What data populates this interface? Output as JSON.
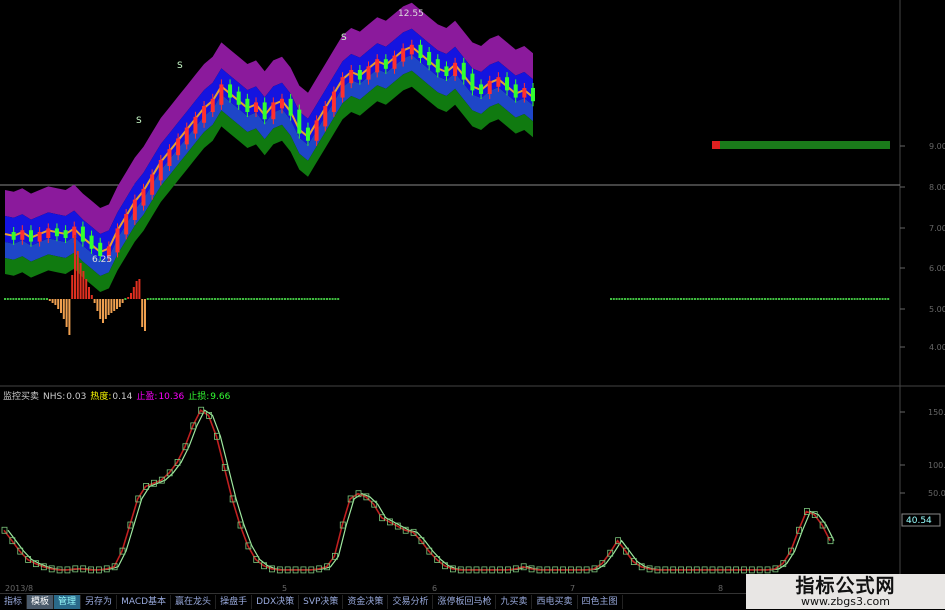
{
  "chart_data": [
    {
      "type": "candlestick",
      "y_axis_ticks": [
        "9.00",
        "8.00",
        "7.00",
        "6.00",
        "5.00",
        "4.00"
      ],
      "ylim": [
        3.2,
        9.6
      ],
      "annotations": {
        "high_label": "12.55",
        "low_label": "6.25",
        "signal_marks": [
          "S",
          "S",
          "S"
        ]
      },
      "price_path": [
        7.3,
        7.25,
        7.35,
        7.2,
        7.3,
        7.4,
        7.35,
        7.3,
        7.45,
        7.2,
        7.0,
        6.8,
        6.9,
        7.4,
        7.8,
        8.2,
        8.5,
        8.9,
        9.3,
        9.6,
        9.9,
        10.2,
        10.5,
        10.8,
        11.0,
        11.4,
        11.2,
        11.0,
        10.8,
        10.9,
        10.6,
        10.9,
        11.0,
        10.7,
        10.2,
        10.0,
        10.4,
        10.8,
        11.2,
        11.6,
        11.8,
        11.7,
        11.9,
        12.1,
        12.0,
        12.2,
        12.4,
        12.5,
        12.3,
        12.1,
        11.9,
        11.8,
        12.0,
        11.7,
        11.4,
        11.3,
        11.5,
        11.6,
        11.4,
        11.2,
        11.3,
        11.1
      ],
      "oscillator": {
        "values": [
          0,
          0,
          0,
          0,
          0,
          0,
          0,
          0,
          0,
          0,
          0,
          0,
          0,
          0,
          0,
          0,
          -0.05,
          -0.1,
          -0.15,
          -0.25,
          -0.35,
          -0.5,
          -0.7,
          -0.9,
          0.6,
          1.6,
          1.2,
          0.9,
          0.7,
          0.5,
          0.3,
          0.1,
          -0.1,
          -0.3,
          -0.5,
          -0.6,
          -0.5,
          -0.4,
          -0.35,
          -0.3,
          -0.25,
          -0.2,
          -0.1,
          0,
          0.05,
          0.15,
          0.3,
          0.45,
          0.5,
          -0.7,
          -0.8
        ],
        "colors": {
          "positive": "#e03020",
          "negative": "#f0a050",
          "zero": "#3fbf3f"
        }
      },
      "far_right_price": 9.0
    },
    {
      "type": "line",
      "header": {
        "indicator": "监控买卖",
        "nhs_label": "NHS:",
        "nhs_value": "0.03",
        "heat_label": "热度:",
        "heat_value": "0.14",
        "stop_loss_label": "止盈:",
        "stop_loss_value": "10.36",
        "stop_profit_label": "止损:",
        "stop_profit_value": "9.66"
      },
      "y_axis_ticks": [
        "150.00",
        "100.00",
        "50.00"
      ],
      "ylim": [
        0,
        160
      ],
      "current_value": "40.54",
      "x_ticks": [
        "2013/8",
        "5",
        "6",
        "7",
        "8"
      ],
      "series_values": [
        40,
        30,
        20,
        12,
        8,
        5,
        3,
        2,
        2,
        3,
        3,
        2,
        2,
        3,
        5,
        20,
        45,
        70,
        82,
        85,
        88,
        95,
        105,
        120,
        140,
        155,
        150,
        130,
        100,
        70,
        45,
        25,
        12,
        6,
        3,
        2,
        2,
        2,
        2,
        2,
        3,
        5,
        15,
        45,
        70,
        75,
        72,
        65,
        52,
        48,
        44,
        40,
        38,
        30,
        20,
        12,
        6,
        3,
        2,
        2,
        2,
        2,
        2,
        2,
        2,
        3,
        5,
        3,
        2,
        2,
        2,
        2,
        2,
        2,
        2,
        3,
        8,
        18,
        30,
        20,
        10,
        5,
        3,
        2,
        2,
        2,
        2,
        2,
        2,
        2,
        2,
        2,
        2,
        2,
        2,
        2,
        2,
        2,
        3,
        8,
        20,
        40,
        58,
        55,
        45,
        30
      ]
    }
  ],
  "tabs": [
    "指标",
    "模板",
    "管理",
    "另存为",
    "MACD基本",
    "赢在龙头",
    "操盘手",
    "DDX决策",
    "SVP决策",
    "资金决策",
    "交易分析",
    "涨停板回马枪",
    "九买卖",
    "西电买卖",
    "四色主图"
  ],
  "watermark": {
    "title": "指标公式网",
    "url": "www.zbgs3.com"
  },
  "colors": {
    "purple": "#8b1a9c",
    "blue": "#1414e0",
    "royal": "#1e46c8",
    "green": "#107a10",
    "bg": "#000000",
    "line_green": "#9fe89f",
    "line_red": "#c02020"
  }
}
